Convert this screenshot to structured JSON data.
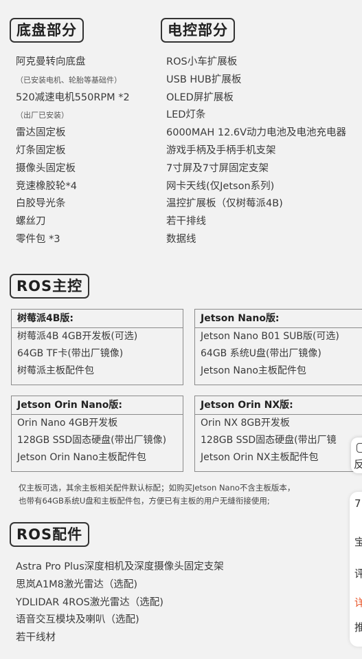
{
  "chassis": {
    "title": "底盘部分",
    "items": [
      {
        "text": "阿克曼转向底盘",
        "note": false
      },
      {
        "text": "（已安装电机、轮胎等基础件）",
        "note": true
      },
      {
        "text": "520减速电机550RPM *2",
        "note": false
      },
      {
        "text": "（出厂已安装）",
        "note": true
      },
      {
        "text": "雷达固定板",
        "note": false
      },
      {
        "text": "灯条固定板",
        "note": false
      },
      {
        "text": "摄像头固定板",
        "note": false
      },
      {
        "text": "竞速橡胶轮*4",
        "note": false
      },
      {
        "text": "白胶导光条",
        "note": false
      },
      {
        "text": "螺丝刀",
        "note": false
      },
      {
        "text": "零件包 *3",
        "note": false
      }
    ]
  },
  "electric": {
    "title": "电控部分",
    "items": [
      "ROS小车扩展板",
      "USB HUB扩展板",
      "OLED屏扩展板",
      "LED灯条",
      "6000MAH 12.6V动力电池及电池充电器",
      "游戏手柄及手柄手机支架",
      "7寸屏及7寸屏固定支架",
      "网卡天线(仅Jetson系列)",
      "温控扩展板（仅树莓派4B)",
      "若干排线",
      "数据线"
    ]
  },
  "ros_main": {
    "title": "ROS主控",
    "boxes": [
      {
        "header": "树莓派4B版:",
        "items": [
          "树莓派4B 4GB开发板(可选)",
          "64GB TF卡(带出厂镜像)",
          "树莓派主板配件包"
        ]
      },
      {
        "header": "Jetson Nano版:",
        "items": [
          "Jetson Nano B01 SUB版(可选)",
          "64GB 系统U盘(带出厂镜像)",
          "Jetson Nano主板配件包"
        ]
      },
      {
        "header": "Jetson Orin Nano版:",
        "items": [
          "Orin Nano 4GB开发板",
          "128GB SSD固态硬盘(带出厂镜像)",
          "Jetson Orin Nano主板配件包"
        ]
      },
      {
        "header": "Jetson Orin NX版:",
        "items": [
          "Orin NX 8GB开发板",
          "128GB SSD固态硬盘(带出厂镜",
          "Jetson Orin NX主板配件包"
        ]
      }
    ],
    "note_line1": "仅主板可选，其余主板相关配件默认标配；如购买Jetson Nano不含主板版本，",
    "note_line2": "也带有64GB系统U盘和主板配件包，方便已有主板的用户无缝衔接使用;"
  },
  "ros_accessories": {
    "title": "ROS配件",
    "items": [
      "Astra Pro Plus深度相机及深度摄像头固定支架",
      "思岚A1M8激光雷达（选配)",
      "YDLIDAR 4ROS激光雷达（选配)",
      "语音交互模块及喇叭（选配)",
      "若干线材"
    ]
  },
  "floating": {
    "feedback_label": "反",
    "side_chars": [
      {
        "ch": "7",
        "color": "#333333"
      },
      {
        "ch": "宝",
        "color": "#333333"
      },
      {
        "ch": "评",
        "color": "#333333"
      },
      {
        "ch": "详",
        "color": "#e8562a"
      },
      {
        "ch": "推",
        "color": "#333333"
      }
    ]
  }
}
